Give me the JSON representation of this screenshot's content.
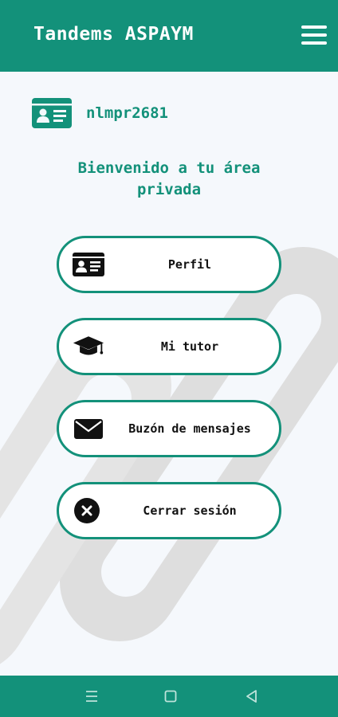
{
  "colors": {
    "primary": "#13917a",
    "background": "#f5f8fc",
    "card_background": "#ffffff",
    "card_text": "#111111",
    "watermark": "#dedede"
  },
  "header": {
    "title": "Tandems ASPAYM",
    "menu_icon": "hamburger-menu-icon"
  },
  "user": {
    "username": "nlmpr2681",
    "icon": "id-card-icon"
  },
  "welcome": {
    "line1": "Bienvenido a tu área",
    "line2": "privada"
  },
  "menu": [
    {
      "label": "Perfil",
      "icon": "id-card-icon"
    },
    {
      "label": "Mi tutor",
      "icon": "graduation-cap-icon"
    },
    {
      "label": "Buzón de mensajes",
      "icon": "envelope-icon"
    },
    {
      "label": "Cerrar sesión",
      "icon": "close-circle-icon"
    }
  ],
  "system_nav": {
    "recents_icon": "recents-icon",
    "home_icon": "home-icon",
    "back_icon": "back-icon"
  }
}
